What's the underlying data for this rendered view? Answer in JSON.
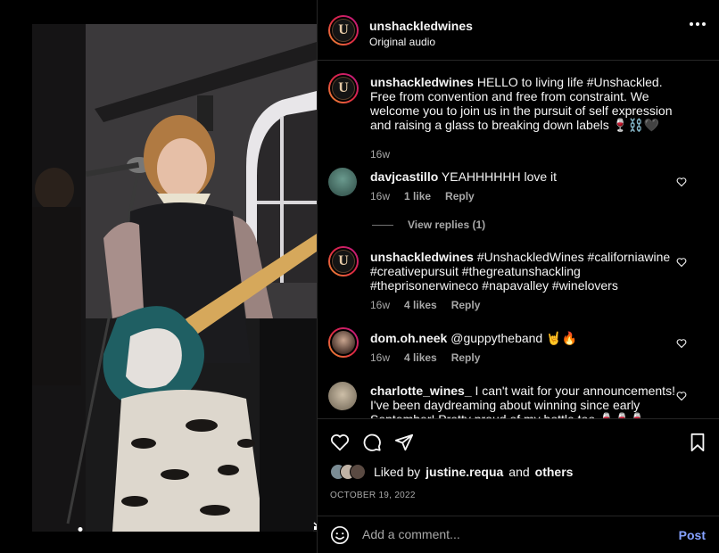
{
  "post": {
    "author": "unshackledwines",
    "audio": "Original audio",
    "logo_letter": "U"
  },
  "caption": {
    "username": "unshackledwines",
    "text": "HELLO to living life #Unshackled. Free from convention and free from constraint. We welcome you to join us in the pursuit of self expression and raising a glass to breaking down labels 🍷⛓️🖤",
    "time": "16w"
  },
  "comments": [
    {
      "username": "davjcastillo",
      "text": "YEAHHHHHH love it",
      "time": "16w",
      "likes": "1 like",
      "reply": "Reply",
      "view_replies": "View replies (1)"
    },
    {
      "username": "unshackledwines",
      "text": "#UnshackledWines #californiawine #creativepursuit #thegreatunshackling #theprisonerwineco #napavalley #winelovers",
      "time": "16w",
      "likes": "4 likes",
      "reply": "Reply"
    },
    {
      "username": "dom.oh.neek",
      "text": "@guppytheband 🤘🔥",
      "time": "16w",
      "likes": "4 likes",
      "reply": "Reply"
    },
    {
      "username": "charlotte_wines_",
      "text": "I can't wait for your announcements! I've been daydreaming about winning since early September! Pretty proud of my bottle too 🍷🍷🍷",
      "time": "",
      "likes": "",
      "reply": ""
    }
  ],
  "likes_line": {
    "prefix": "Liked by",
    "user": "justine.requa",
    "and": "and",
    "others": "others"
  },
  "date": "OCTOBER 19, 2022",
  "add_comment": {
    "placeholder": "Add a comment...",
    "post_label": "Post"
  },
  "icons": {
    "like": "heart-icon",
    "comment": "comment-icon",
    "share": "paper-plane-icon",
    "save": "bookmark-icon",
    "emoji": "emoji-icon",
    "mute": "speaker-muted-icon",
    "tagged": "user-icon"
  },
  "colors": {
    "background": "#000000",
    "text": "#f5f5f5",
    "muted": "#a8a8a8",
    "post_link": "#85a1ff"
  }
}
